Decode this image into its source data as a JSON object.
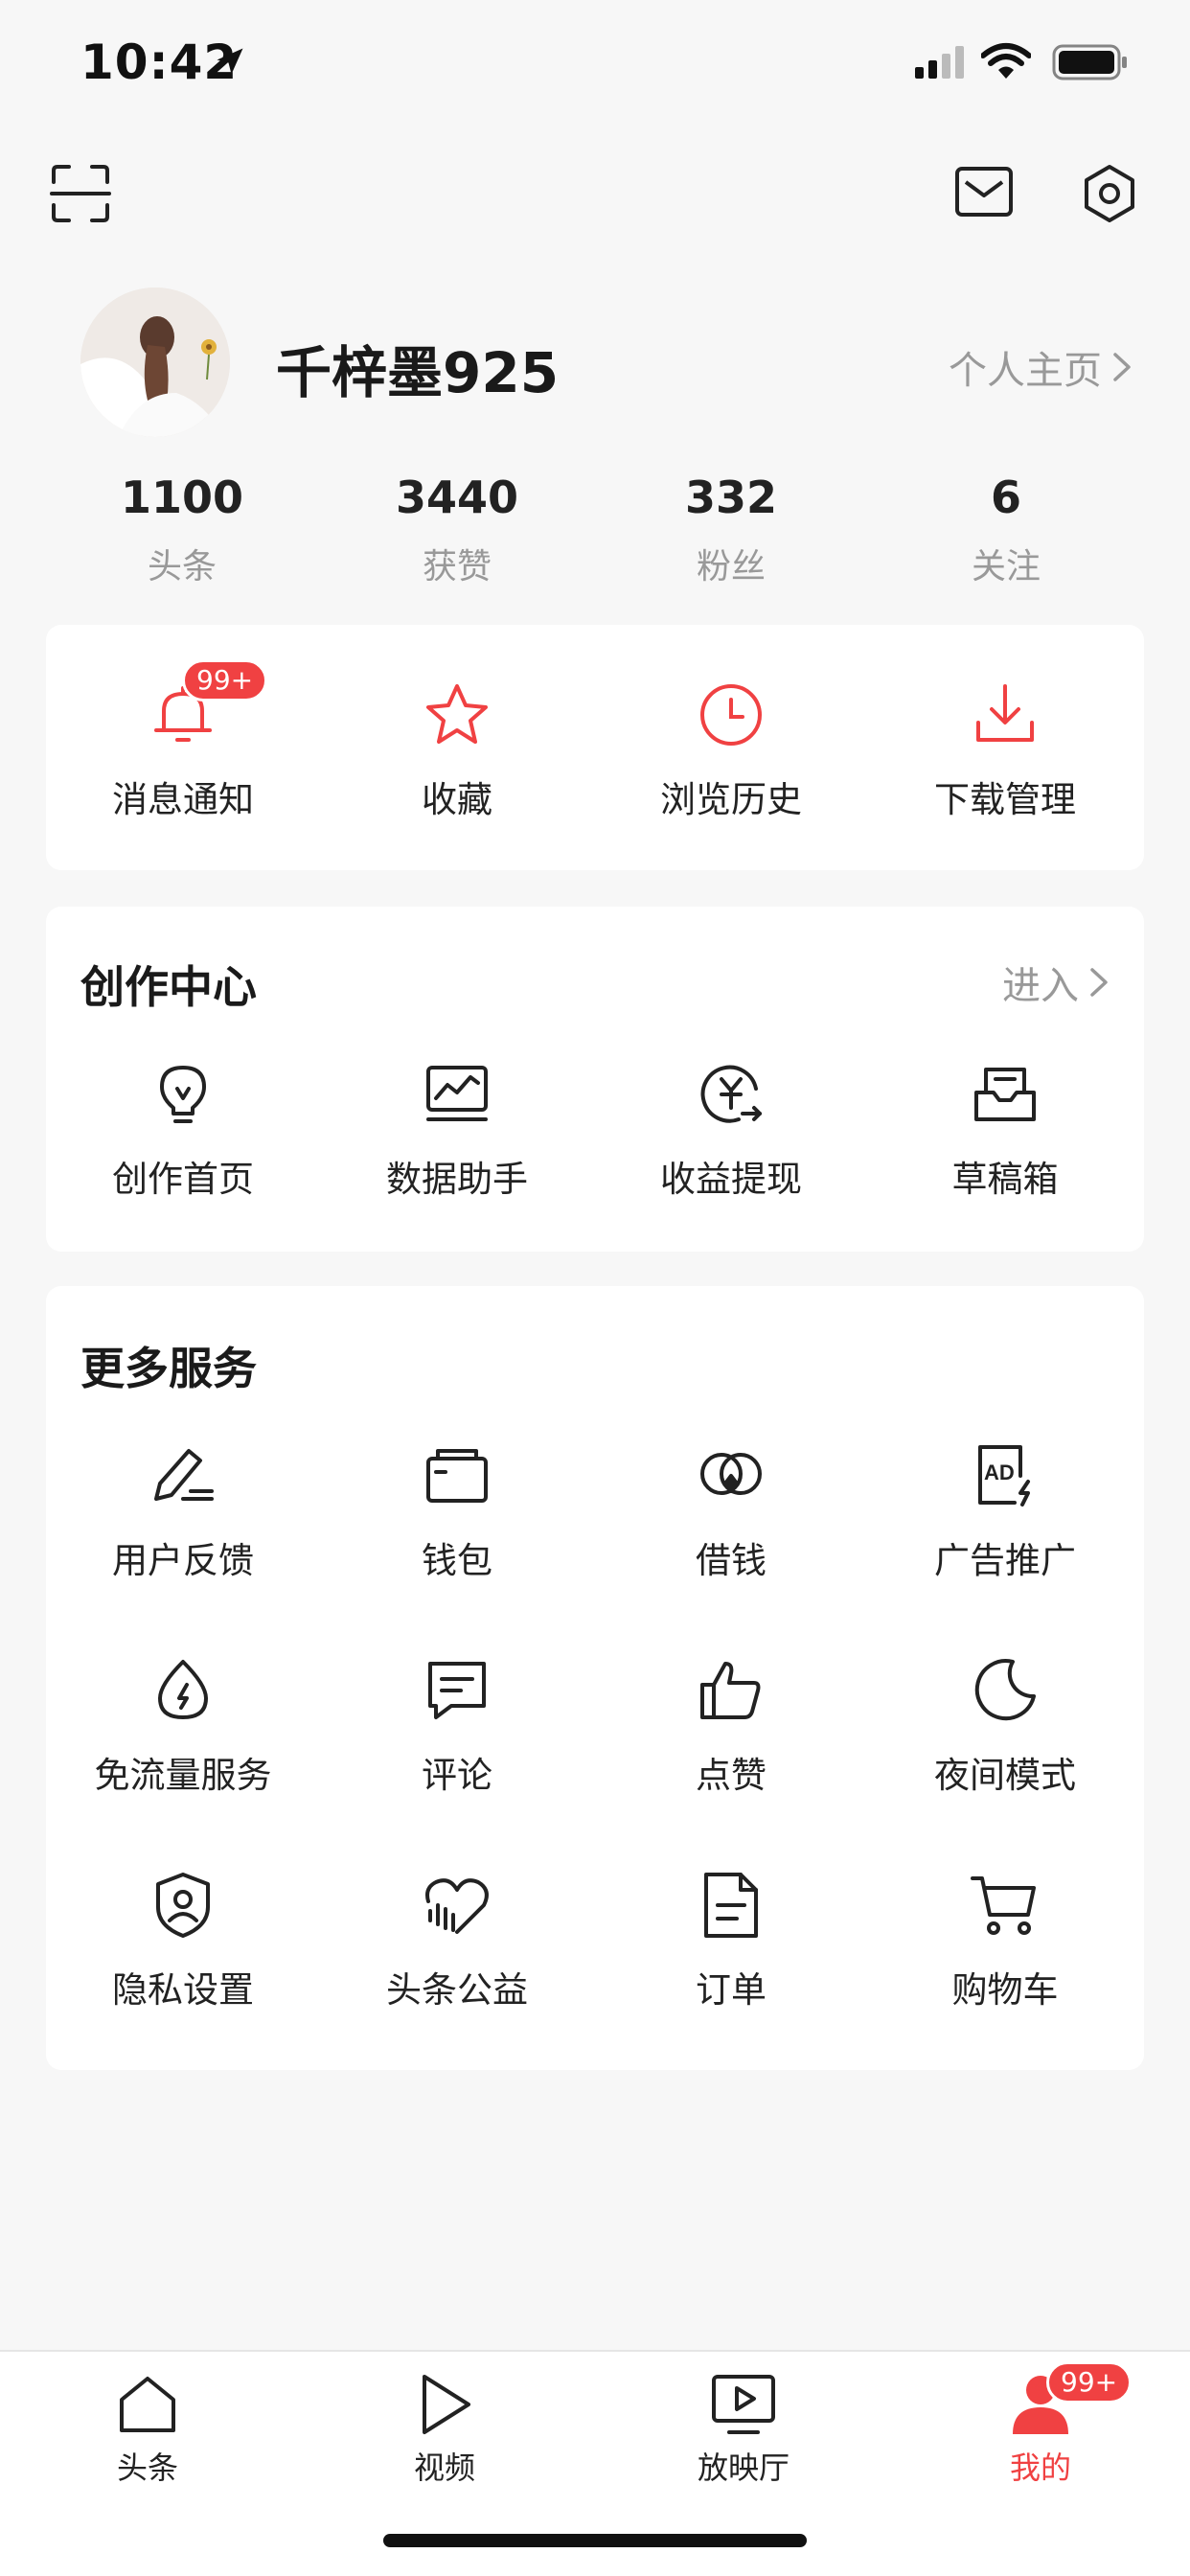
{
  "status": {
    "time": "10:42"
  },
  "profile": {
    "username": "千梓墨925",
    "homepage_label": "个人主页",
    "stats": [
      {
        "value": "1100",
        "label": "头条"
      },
      {
        "value": "3440",
        "label": "获赞"
      },
      {
        "value": "332",
        "label": "粉丝"
      },
      {
        "value": "6",
        "label": "关注"
      }
    ]
  },
  "quick": {
    "items": [
      {
        "label": "消息通知",
        "icon": "bell-icon",
        "badge": "99+"
      },
      {
        "label": "收藏",
        "icon": "star-icon"
      },
      {
        "label": "浏览历史",
        "icon": "clock-icon"
      },
      {
        "label": "下载管理",
        "icon": "download-icon"
      }
    ],
    "accent": "#f04142"
  },
  "creation": {
    "title": "创作中心",
    "enter_label": "进入",
    "items": [
      {
        "label": "创作首页",
        "icon": "lightbulb-icon"
      },
      {
        "label": "数据助手",
        "icon": "chart-monitor-icon"
      },
      {
        "label": "收益提现",
        "icon": "yuan-withdraw-icon"
      },
      {
        "label": "草稿箱",
        "icon": "draft-box-icon"
      }
    ]
  },
  "services": {
    "title": "更多服务",
    "items": [
      {
        "label": "用户反馈",
        "icon": "pen-feedback-icon"
      },
      {
        "label": "钱包",
        "icon": "wallet-icon"
      },
      {
        "label": "借钱",
        "icon": "loan-icon"
      },
      {
        "label": "广告推广",
        "icon": "ad-icon"
      },
      {
        "label": "免流量服务",
        "icon": "data-free-icon"
      },
      {
        "label": "评论",
        "icon": "comment-icon"
      },
      {
        "label": "点赞",
        "icon": "thumbs-up-icon"
      },
      {
        "label": "夜间模式",
        "icon": "moon-icon"
      },
      {
        "label": "隐私设置",
        "icon": "privacy-shield-icon"
      },
      {
        "label": "头条公益",
        "icon": "charity-heart-icon"
      },
      {
        "label": "订单",
        "icon": "order-doc-icon"
      },
      {
        "label": "购物车",
        "icon": "cart-icon"
      }
    ]
  },
  "tabbar": {
    "tabs": [
      {
        "label": "头条",
        "icon": "home-icon"
      },
      {
        "label": "视频",
        "icon": "play-icon"
      },
      {
        "label": "放映厅",
        "icon": "screen-play-icon"
      },
      {
        "label": "我的",
        "icon": "user-icon",
        "active": true,
        "badge": "99+"
      }
    ]
  }
}
